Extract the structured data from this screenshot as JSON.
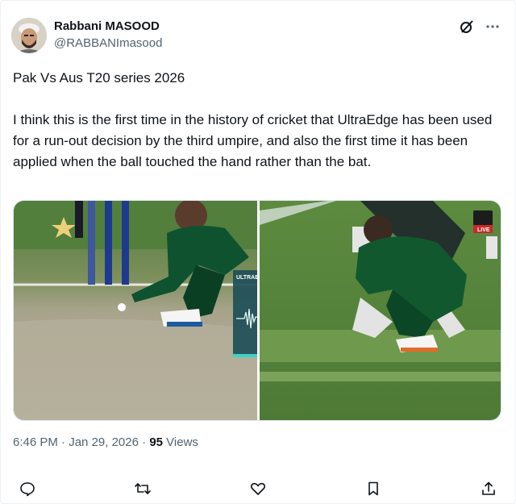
{
  "author": {
    "name": "Rabbani MASOOD",
    "handle": "@RABBANImasood"
  },
  "post": {
    "line1": "Pak Vs Aus T20 series 2026",
    "body": "I think this is the first time in the history of cricket that UltraEdge has been used for a run-out decision by the third umpire, and also the first time it has been applied when the ball touched the hand rather than the bat."
  },
  "media": {
    "ultraedge_label": "ULTRAEDGE",
    "broadcaster_label": "LIVE"
  },
  "meta": {
    "time": "6:46 PM",
    "separator": "·",
    "date": "Jan 29, 2026",
    "views_count": "95",
    "views_label": "Views"
  },
  "icons": {
    "grok": "grok-icon",
    "more": "more-icon",
    "reply": "reply-icon",
    "repost": "repost-icon",
    "like": "like-icon",
    "bookmark": "bookmark-icon",
    "share": "share-icon"
  },
  "colors": {
    "text": "#0f1419",
    "secondary": "#536471",
    "jersey": "#0d4a2b",
    "pitch": "#a9a48e",
    "grass": "#5d8d3f"
  }
}
